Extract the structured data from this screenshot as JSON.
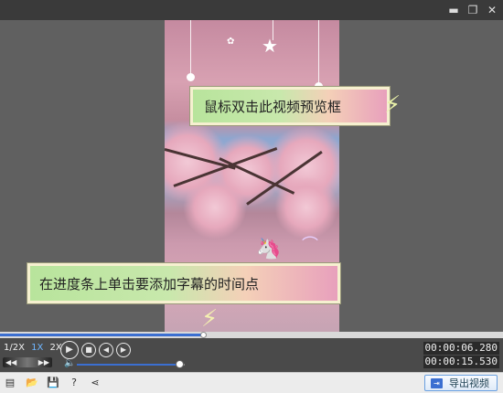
{
  "window": {
    "restore_icon": "restore-icon",
    "close_icon": "close-icon"
  },
  "callouts": {
    "top": "鼠标双击此视频预览框",
    "bottom": "在进度条上单击要添加字幕的时间点"
  },
  "playback": {
    "progress_fraction": 0.403,
    "speeds": [
      "1/2X",
      "1X",
      "2X"
    ],
    "active_speed": "1X",
    "volume_fraction": 0.95,
    "current_time": "00:00:06.280",
    "total_time": "00:00:15.530"
  },
  "toolbar": {
    "export_label": "导出视频"
  },
  "colors": {
    "accent": "#3b6fd1",
    "callout_start": "#b8e49c",
    "callout_end": "#e8a0bc"
  }
}
